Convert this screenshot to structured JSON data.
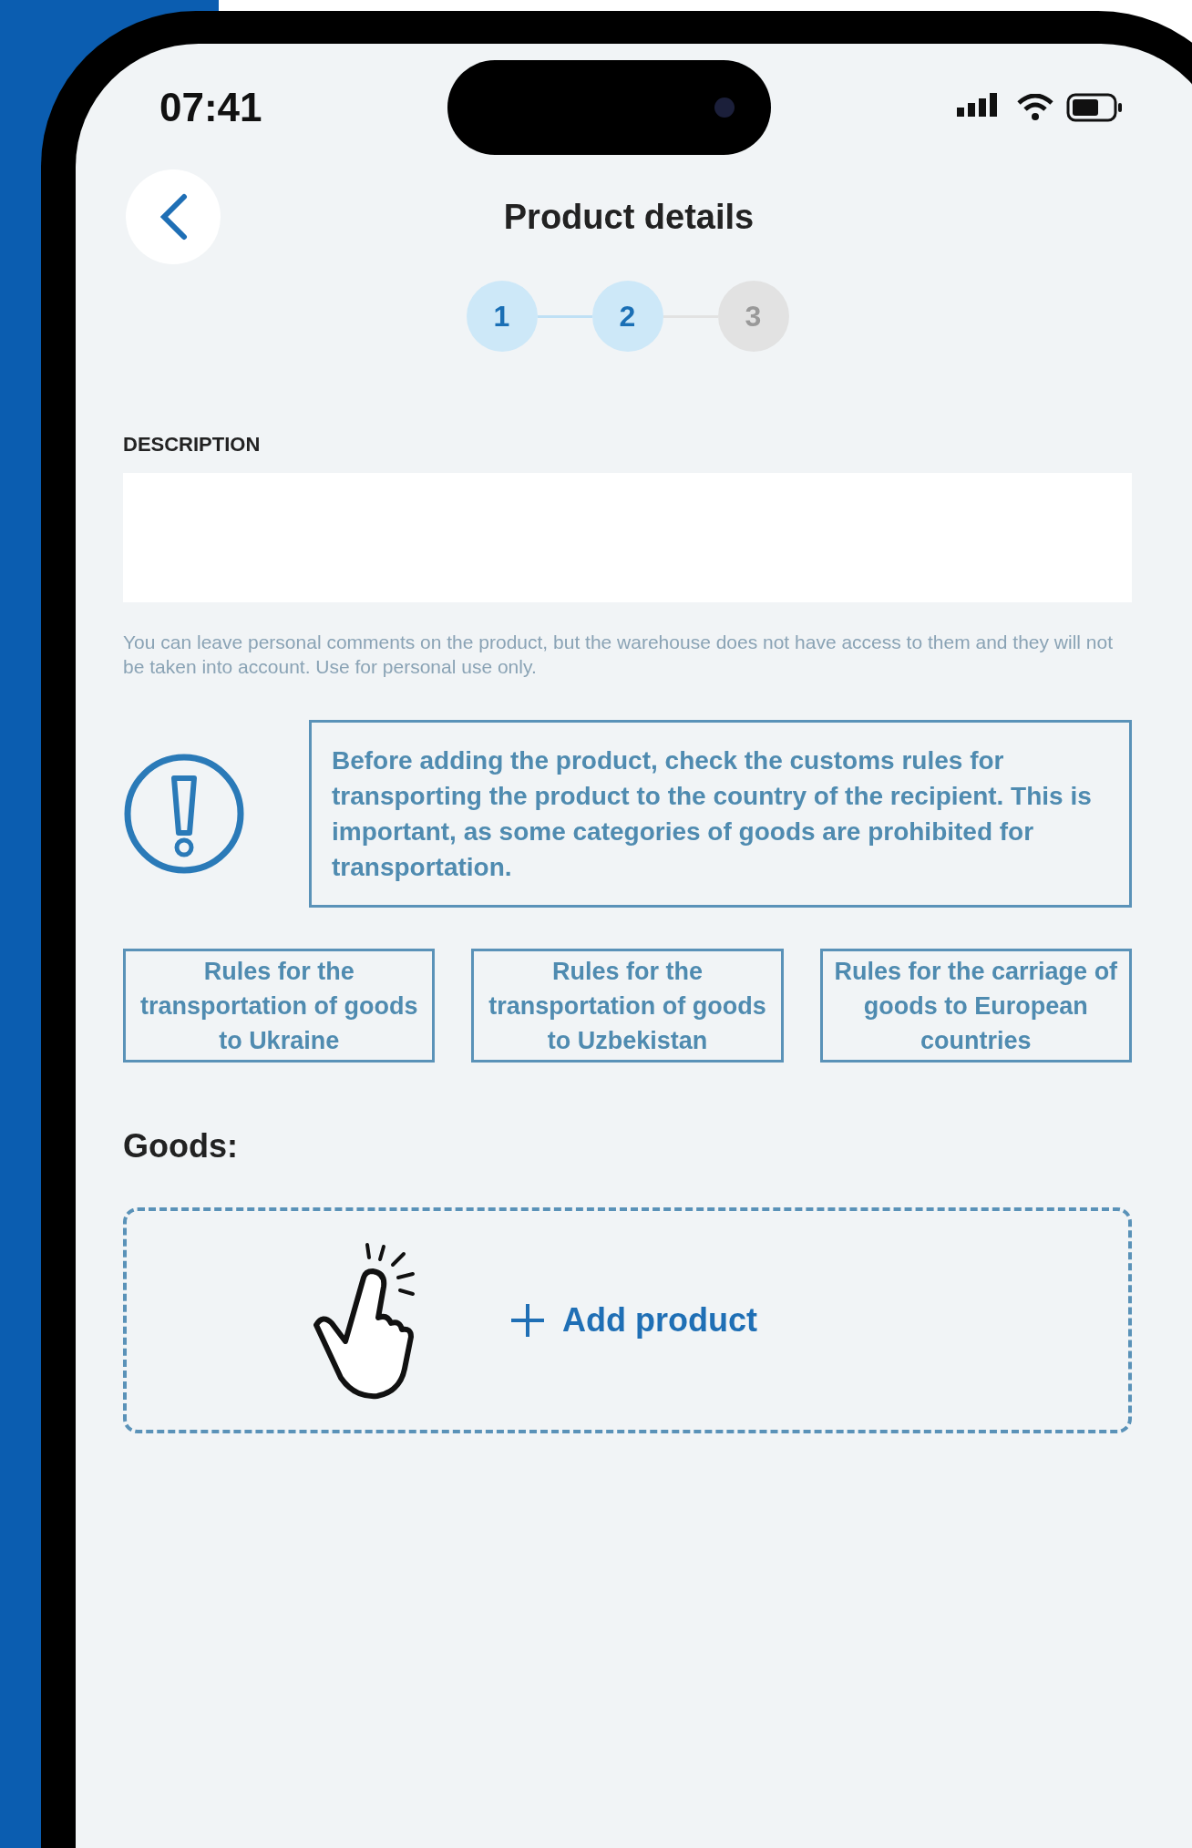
{
  "status_bar": {
    "time": "07:41"
  },
  "header": {
    "title": "Product details"
  },
  "steps": [
    {
      "label": "1",
      "active": true
    },
    {
      "label": "2",
      "active": true
    },
    {
      "label": "3",
      "active": false
    }
  ],
  "description": {
    "label": "DESCRIPTION",
    "helper": "You can leave personal comments on the product, but the warehouse does not have access to them and they will not be taken into account. Use for personal use only."
  },
  "warning": {
    "text": "Before adding the product, check the customs rules for transporting the product to the country of the recipient. This is important, as some categories of goods are prohibited for transportation."
  },
  "rule_links": [
    "Rules for the transportation of goods to Ukraine",
    "Rules for the transportation of goods to Uzbekistan",
    "Rules for the carriage of goods to European countries"
  ],
  "goods": {
    "label": "Goods:",
    "add_button": "Add product"
  }
}
